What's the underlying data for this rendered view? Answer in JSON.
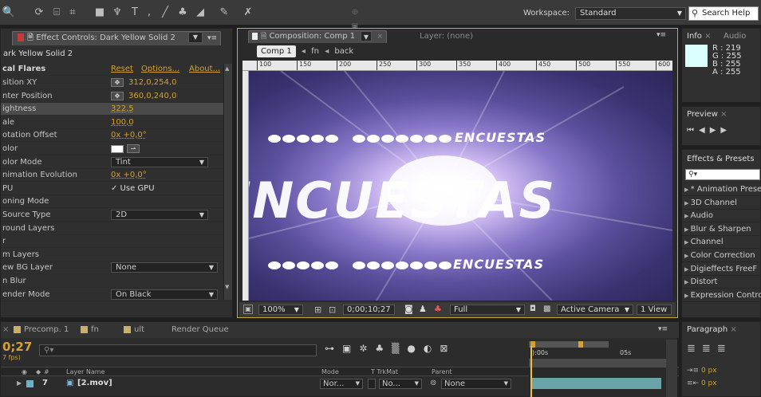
{
  "toolbar": {
    "workspace_label": "Workspace:",
    "workspace_value": "Standard",
    "search_placeholder": "Search Help"
  },
  "effect_controls": {
    "tab_label": "Effect Controls: Dark Yellow Solid 2",
    "layer_name": "ark Yellow Solid 2",
    "effect_name": "cal Flares",
    "reset": "Reset",
    "options": "Options...",
    "about": "About...",
    "rows": [
      {
        "label": "sition XY",
        "value": "312,0,254,0",
        "kind": "point"
      },
      {
        "label": "nter Position",
        "value": "360,0,240,0",
        "kind": "point"
      },
      {
        "label": "ightness",
        "value": "322,5",
        "kind": "num"
      },
      {
        "label": "ale",
        "value": "100,0",
        "kind": "num"
      },
      {
        "label": "otation Offset",
        "value": "0x +0,0°",
        "kind": "num"
      },
      {
        "label": "olor",
        "value": "",
        "kind": "color"
      },
      {
        "label": "olor Mode",
        "value": "Tint",
        "kind": "dropdown"
      },
      {
        "label": "nimation Evolution",
        "value": "0x +0,0°",
        "kind": "num"
      },
      {
        "label": "PU",
        "value": "✓ Use GPU",
        "kind": "check"
      },
      {
        "label": "oning Mode",
        "value": "",
        "kind": "none"
      },
      {
        "label": "Source Type",
        "value": "2D",
        "kind": "dropdown"
      },
      {
        "label": "round Layers",
        "value": "",
        "kind": "none"
      },
      {
        "label": "r",
        "value": "",
        "kind": "none"
      },
      {
        "label": "m Layers",
        "value": "",
        "kind": "none"
      },
      {
        "label": "ew BG Layer",
        "value": "None",
        "kind": "dropdown"
      },
      {
        "label": "n Blur",
        "value": "",
        "kind": "none"
      },
      {
        "label": "ender Mode",
        "value": "On Black",
        "kind": "dropdown"
      }
    ]
  },
  "composition": {
    "tab_label": "Composition: Comp 1",
    "layer_tab": "Layer: (none)",
    "breadcrumb": [
      "Comp 1",
      "fn",
      "back"
    ],
    "ruler": [
      "100",
      "150",
      "200",
      "250",
      "300",
      "350",
      "400",
      "450",
      "500",
      "550",
      "600"
    ],
    "viewer_text": "ENCUESTAS",
    "zoom": "100%",
    "timecode": "0;00;10;27",
    "resolution": "Full",
    "camera": "Active Camera",
    "views": "1 View"
  },
  "info": {
    "tab": "Info",
    "tab2": "Audio",
    "r": "R : 219",
    "g": "G : 255",
    "b": "B : 255",
    "a": "A : 255",
    "swatch": "#dbffff"
  },
  "preview": {
    "tab": "Preview"
  },
  "effects_presets": {
    "tab": "Effects & Presets",
    "items": [
      "* Animation Prese",
      "3D Channel",
      "Audio",
      "Blur & Sharpen",
      "Channel",
      "Color Correction",
      "Digieffects FreeF",
      "Distort",
      "Expression Contro"
    ]
  },
  "timeline": {
    "tabs": [
      {
        "label": "Precomp. 1",
        "color": "#c8b068"
      },
      {
        "label": "fn",
        "color": "#c8b068"
      },
      {
        "label": "ult",
        "color": "#c8b068"
      },
      {
        "label": "Render Queue",
        "color": ""
      }
    ],
    "time": "0;27",
    "fps": "7 fps)",
    "header": {
      "layer_name": "Layer Name",
      "mode": "Mode",
      "trkmat": "T  TrkMat",
      "parent": "Parent"
    },
    "layer": {
      "num": "7",
      "name": "[2.mov]",
      "mode": "Nor...",
      "trkmat": "No...",
      "parent": "None"
    },
    "ruler": [
      "):00s",
      "05s"
    ]
  },
  "paragraph": {
    "tab": "Paragraph",
    "px1": "0 px",
    "px2": "0 px"
  }
}
